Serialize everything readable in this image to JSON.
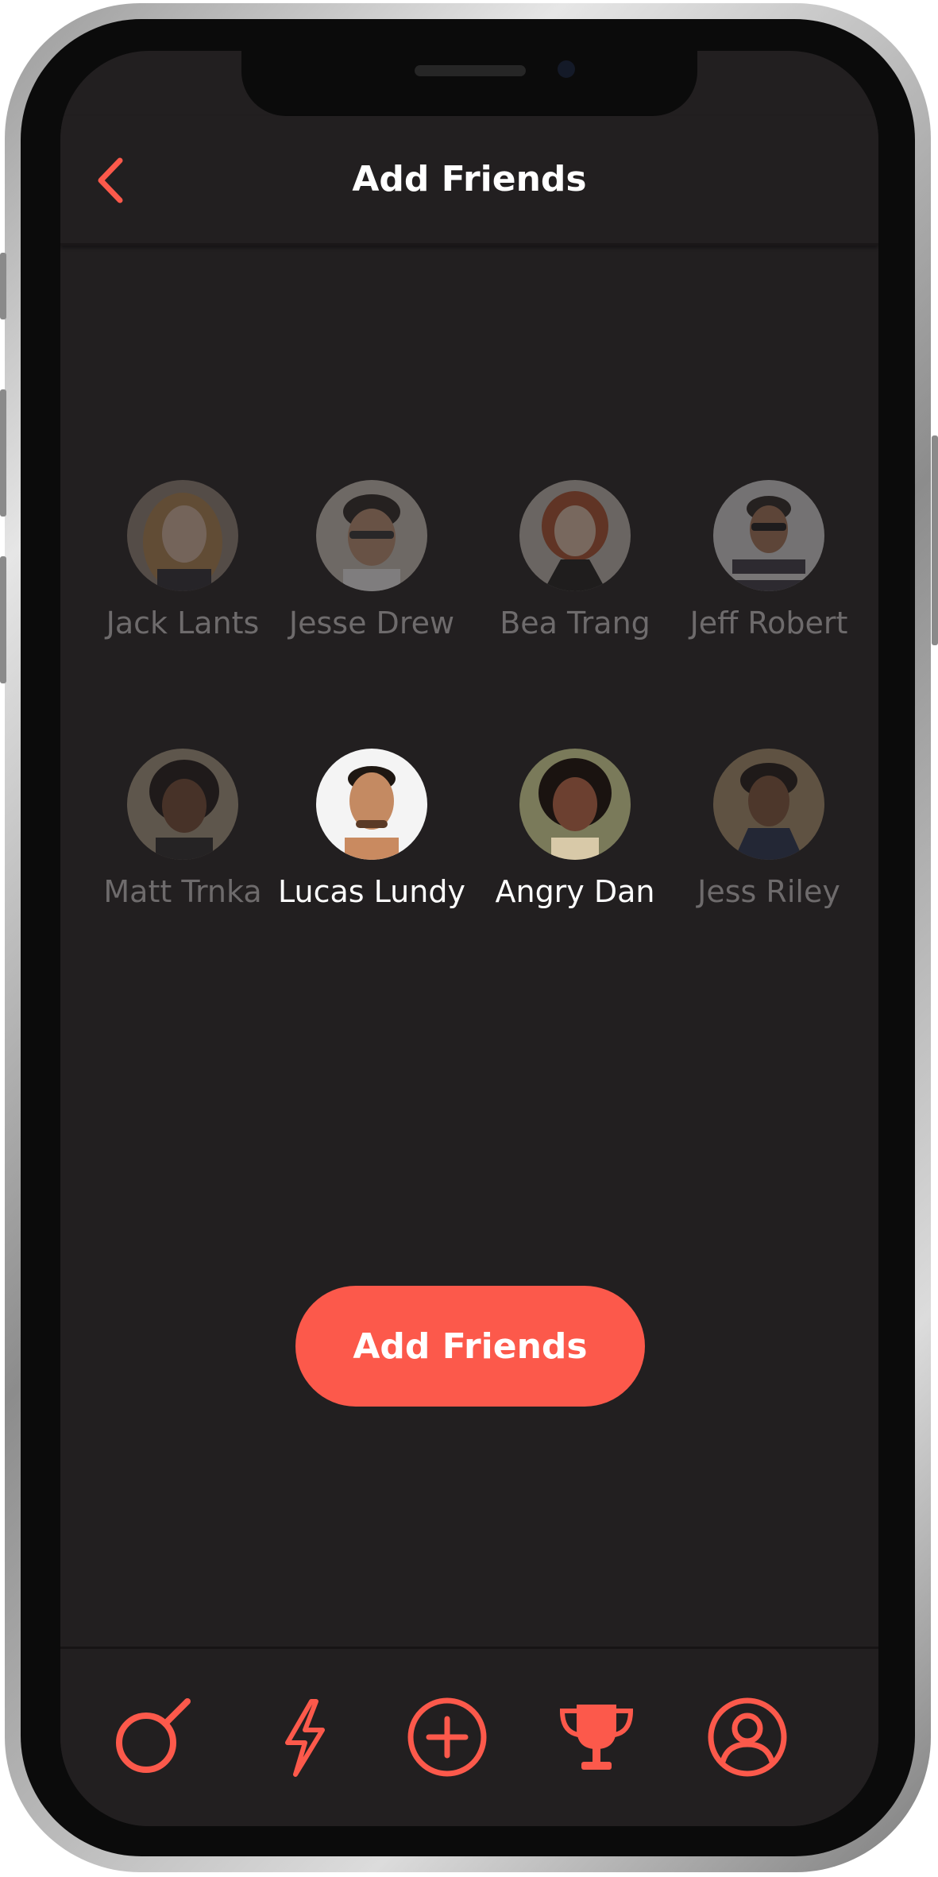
{
  "header": {
    "title": "Add Friends",
    "back_icon": "chevron-left-icon"
  },
  "friends": [
    {
      "name": "Jack Lants",
      "selected": false
    },
    {
      "name": "Jesse Drew",
      "selected": false
    },
    {
      "name": "Bea Trang",
      "selected": false
    },
    {
      "name": "Jeff Robert",
      "selected": false
    },
    {
      "name": "Matt Trnka",
      "selected": false
    },
    {
      "name": "Lucas Lundy",
      "selected": true
    },
    {
      "name": "Angry Dan",
      "selected": true
    },
    {
      "name": "Jess Riley",
      "selected": false
    }
  ],
  "cta": {
    "label": "Add Friends"
  },
  "tabs": [
    {
      "icon": "search-icon"
    },
    {
      "icon": "lightning-icon"
    },
    {
      "icon": "add-circle-icon"
    },
    {
      "icon": "trophy-icon"
    },
    {
      "icon": "profile-icon"
    }
  ],
  "colors": {
    "accent": "#fc594b",
    "background": "#221f20",
    "text_active": "#ffffff",
    "text_inactive": "#6e6b6c"
  }
}
